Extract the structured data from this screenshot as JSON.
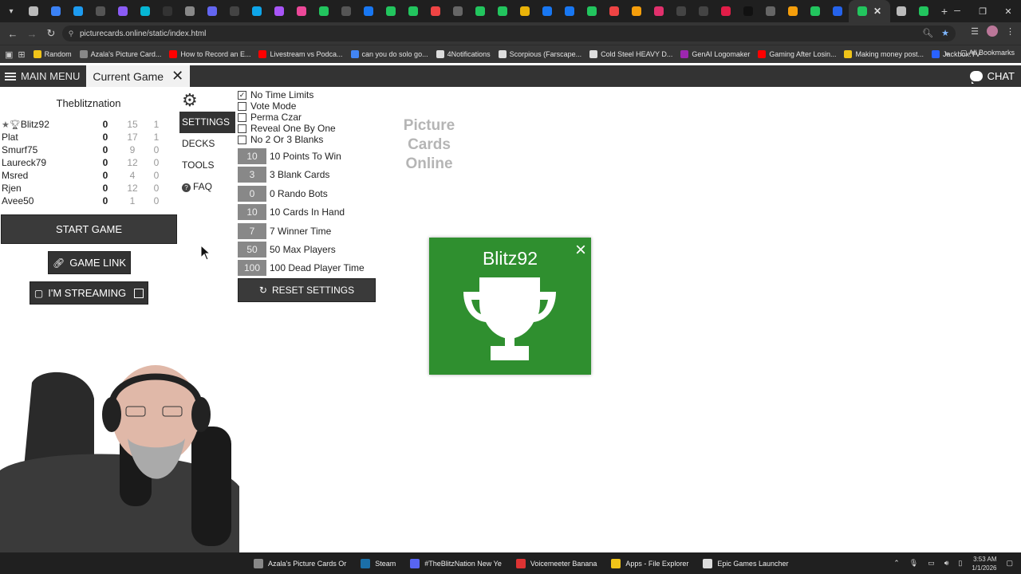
{
  "browser": {
    "url": "picturecards.online/static/index.html",
    "bookmarks": [
      {
        "label": "Random",
        "color": "#f0c419"
      },
      {
        "label": "Azala's Picture Card...",
        "color": "#888"
      },
      {
        "label": "How to Record an E...",
        "color": "#ff0000"
      },
      {
        "label": "Livestream vs Podca...",
        "color": "#ff0000"
      },
      {
        "label": "can you do solo go...",
        "color": "#4285f4"
      },
      {
        "label": "4Notifications",
        "color": "#dddddd"
      },
      {
        "label": "Scorpious (Farscape...",
        "color": "#dddddd"
      },
      {
        "label": "Cold Steel HEAVY D...",
        "color": "#dddddd"
      },
      {
        "label": "GenAI Logomaker",
        "color": "#9c27b0"
      },
      {
        "label": "Gaming After Losin...",
        "color": "#ff0000"
      },
      {
        "label": "Making money post...",
        "color": "#f0c419"
      },
      {
        "label": "Jackbox.TV",
        "color": "#2962ff"
      }
    ],
    "all_bookmarks": "All Bookmarks"
  },
  "header": {
    "main_menu": "MAIN MENU",
    "current_tab": "Current Game",
    "chat": "CHAT"
  },
  "room": {
    "name": "Theblitznation"
  },
  "players": [
    {
      "name": "Blitz92",
      "score": "0",
      "col2": "15",
      "col3": "1",
      "host": true
    },
    {
      "name": "Plat",
      "score": "0",
      "col2": "17",
      "col3": "1"
    },
    {
      "name": "Smurf75",
      "score": "0",
      "col2": "9",
      "col3": "0"
    },
    {
      "name": "Laureck79",
      "score": "0",
      "col2": "12",
      "col3": "0"
    },
    {
      "name": "Msred",
      "score": "0",
      "col2": "4",
      "col3": "0"
    },
    {
      "name": "Rjen",
      "score": "0",
      "col2": "12",
      "col3": "0"
    },
    {
      "name": "Avee50",
      "score": "0",
      "col2": "1",
      "col3": "0"
    }
  ],
  "buttons": {
    "start_game": "START GAME",
    "game_link": "GAME LINK",
    "streaming": "I'M STREAMING",
    "reset_settings": "RESET SETTINGS"
  },
  "nav": {
    "settings": "SETTINGS",
    "decks": "DECKS",
    "tools": "TOOLS",
    "faq": "FAQ"
  },
  "settings": {
    "checkboxes": [
      {
        "label": "No Time Limits",
        "checked": true
      },
      {
        "label": "Vote Mode",
        "checked": false
      },
      {
        "label": "Perma Czar",
        "checked": false
      },
      {
        "label": "Reveal One By One",
        "checked": false
      },
      {
        "label": "No 2 Or 3 Blanks",
        "checked": false
      }
    ],
    "numbers": [
      {
        "value": "10",
        "label": "10 Points To Win"
      },
      {
        "value": "3",
        "label": "3 Blank Cards"
      },
      {
        "value": "0",
        "label": "0 Rando Bots"
      },
      {
        "value": "10",
        "label": "10 Cards In Hand"
      },
      {
        "value": "7",
        "label": "7 Winner Time"
      },
      {
        "value": "50",
        "label": "50 Max Players"
      },
      {
        "value": "100",
        "label": "100 Dead Player Time"
      }
    ]
  },
  "logo": {
    "line1": "Picture",
    "line2": "Cards",
    "line3": "Online"
  },
  "winner_popup": {
    "name": "Blitz92",
    "color": "#2f8f2f"
  },
  "taskbar": {
    "tasks": [
      {
        "label": "Azala's Picture Cards Or",
        "color": "#888"
      },
      {
        "label": "Steam",
        "color": "#1b6fa8"
      },
      {
        "label": "#TheBlitzNation New Ye",
        "color": "#5865f2"
      },
      {
        "label": "Voicemeeter Banana",
        "color": "#d33"
      },
      {
        "label": "Apps - File Explorer",
        "color": "#f0c419"
      },
      {
        "label": "Epic Games Launcher",
        "color": "#dddddd"
      }
    ],
    "time": "3:53 AM",
    "date": "1/1/2026"
  }
}
